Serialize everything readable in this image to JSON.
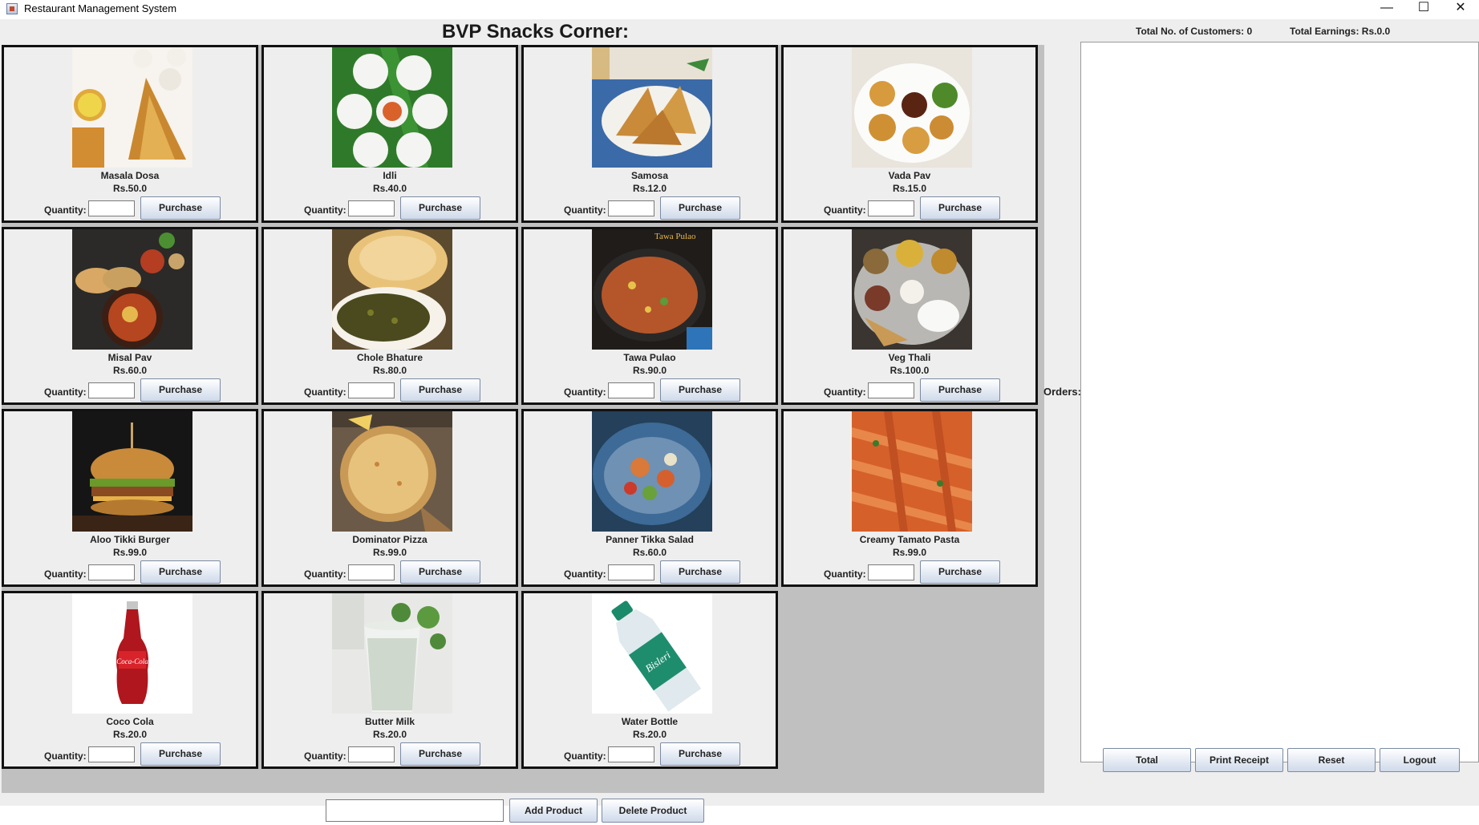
{
  "window": {
    "title": "Restaurant Management System",
    "minimize": "—",
    "maximize": "☐",
    "close": "✕"
  },
  "header": {
    "title": "BVP Snacks Corner:"
  },
  "stats": {
    "customers": "Total No. of Customers: 0",
    "earnings": "Total Earnings: Rs.0.0"
  },
  "labels": {
    "quantity": "Quantity:",
    "purchase": "Purchase",
    "orders": "Orders:"
  },
  "products": [
    {
      "name": "Masala Dosa",
      "price": "Rs.50.0",
      "image": "masala-dosa"
    },
    {
      "name": "Idli",
      "price": "Rs.40.0",
      "image": "idli"
    },
    {
      "name": "Samosa",
      "price": "Rs.12.0",
      "image": "samosa"
    },
    {
      "name": "Vada Pav",
      "price": "Rs.15.0",
      "image": "vada-pav"
    },
    {
      "name": "Misal Pav",
      "price": "Rs.60.0",
      "image": "misal-pav"
    },
    {
      "name": "Chole Bhature",
      "price": "Rs.80.0",
      "image": "chole-bhature"
    },
    {
      "name": "Tawa Pulao",
      "price": "Rs.90.0",
      "image": "tawa-pulao",
      "image_caption": "Tawa Pulao"
    },
    {
      "name": "Veg Thali",
      "price": "Rs.100.0",
      "image": "veg-thali"
    },
    {
      "name": "Aloo Tikki Burger",
      "price": "Rs.99.0",
      "image": "burger"
    },
    {
      "name": "Dominator Pizza",
      "price": "Rs.99.0",
      "image": "pizza"
    },
    {
      "name": "Panner Tikka Salad",
      "price": "Rs.60.0",
      "image": "salad"
    },
    {
      "name": "Creamy Tamato Pasta",
      "price": "Rs.99.0",
      "image": "pasta"
    },
    {
      "name": "Coco Cola",
      "price": "Rs.20.0",
      "image": "coca-cola",
      "image_caption": "Coca-Cola"
    },
    {
      "name": "Butter Milk",
      "price": "Rs.20.0",
      "image": "butter-milk"
    },
    {
      "name": "Water Bottle",
      "price": "Rs.20.0",
      "image": "water-bottle",
      "image_caption": "Bisleri"
    }
  ],
  "bottom": {
    "new_product_value": "",
    "add_label": "Add Product",
    "delete_label": "Delete Product"
  },
  "actions": {
    "total": "Total",
    "print_receipt": "Print Receipt",
    "reset": "Reset",
    "logout": "Logout"
  },
  "colors": {
    "button_border": "#7b8ba3",
    "card_border": "#111111",
    "panel_bg": "#eeeeee",
    "empty_cell": "#c0c0c0"
  }
}
